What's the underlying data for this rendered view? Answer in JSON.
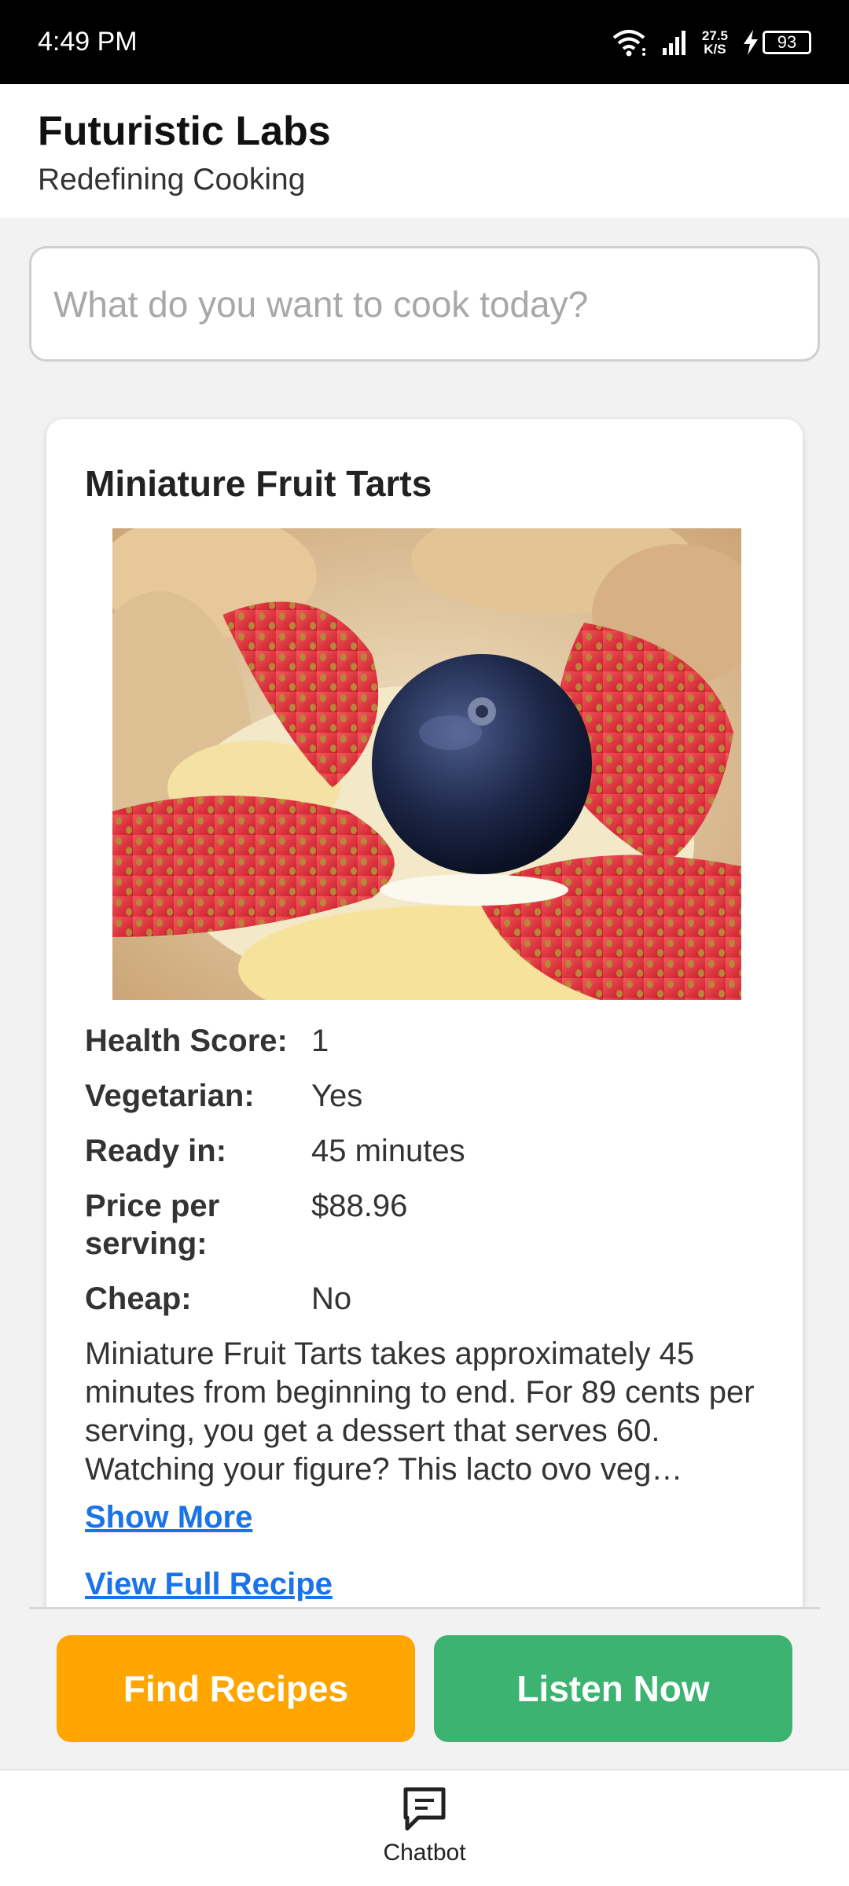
{
  "status_bar": {
    "time": "4:49 PM",
    "net_speed_value": "27.5",
    "net_speed_unit": "K/S",
    "battery": "93"
  },
  "header": {
    "title": "Futuristic Labs",
    "subtitle": "Redefining Cooking"
  },
  "search": {
    "placeholder": "What do you want to cook today?",
    "value": ""
  },
  "recipe": {
    "title": "Miniature Fruit Tarts",
    "image_alt_icon": "fruit-tart-photo",
    "info": [
      {
        "label": "Health Score:",
        "value": "1"
      },
      {
        "label": "Vegetarian:",
        "value": "Yes"
      },
      {
        "label": "Ready in:",
        "value": "45 minutes"
      },
      {
        "label": "Price per serving:",
        "value": "$88.96"
      },
      {
        "label": "Cheap:",
        "value": "No"
      }
    ],
    "description": "Miniature Fruit Tarts takes approximately 45 minutes from beginning to end. For 89 cents per serving, you get a dessert that serves 60. Watching your figure? This lacto ovo veg…",
    "show_more_label": "Show More",
    "view_full_label": "View Full Recipe"
  },
  "actions": {
    "find_recipes_label": "Find Recipes",
    "listen_now_label": "Listen Now",
    "find_color": "#ffa500",
    "listen_color": "#3cb371"
  },
  "bottom_nav": {
    "chatbot_label": "Chatbot",
    "chatbot_icon": "chat-bubble-icon"
  }
}
